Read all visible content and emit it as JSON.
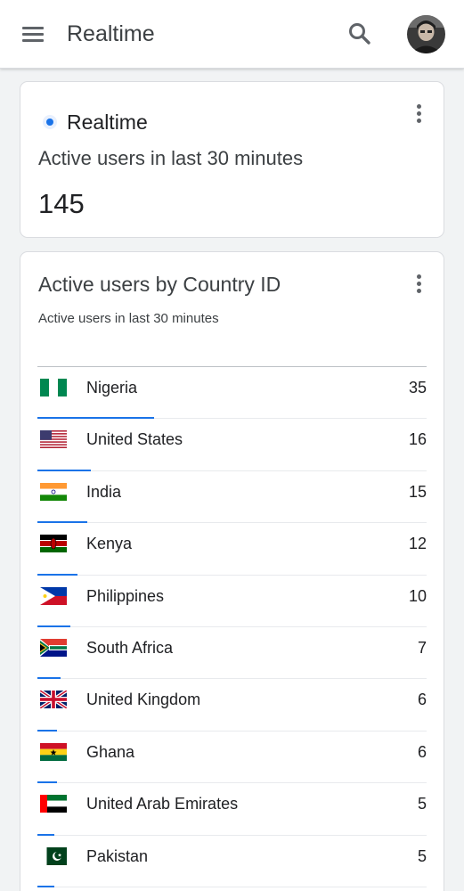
{
  "appbar": {
    "title": "Realtime"
  },
  "realtime_card": {
    "label": "Realtime",
    "metric_label": "Active users in last 30 minutes",
    "metric_value": "145"
  },
  "country_card": {
    "title": "Active users by Country ID",
    "subtitle": "Active users in last 30 minutes",
    "rows": [
      {
        "country": "Nigeria",
        "value": "35",
        "flag": "ng"
      },
      {
        "country": "United States",
        "value": "16",
        "flag": "us"
      },
      {
        "country": "India",
        "value": "15",
        "flag": "in"
      },
      {
        "country": "Kenya",
        "value": "12",
        "flag": "ke"
      },
      {
        "country": "Philippines",
        "value": "10",
        "flag": "ph"
      },
      {
        "country": "South Africa",
        "value": "7",
        "flag": "za"
      },
      {
        "country": "United Kingdom",
        "value": "6",
        "flag": "gb"
      },
      {
        "country": "Ghana",
        "value": "6",
        "flag": "gh"
      },
      {
        "country": "United Arab Emirates",
        "value": "5",
        "flag": "ae"
      },
      {
        "country": "Pakistan",
        "value": "5",
        "flag": "pk"
      }
    ]
  },
  "colors": {
    "accent": "#1a73e8",
    "text": "#202124",
    "background": "#f1f3f4"
  }
}
